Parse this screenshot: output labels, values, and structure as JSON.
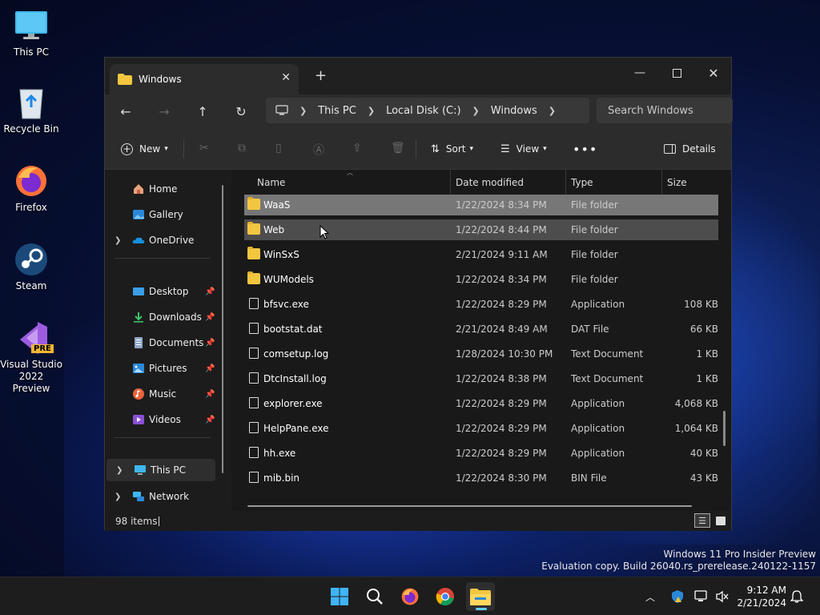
{
  "desktop": {
    "icons": [
      {
        "label": "This PC",
        "icon": "monitor-icon"
      },
      {
        "label": "Recycle Bin",
        "icon": "recycle-bin-icon"
      },
      {
        "label": "Firefox",
        "icon": "firefox-icon"
      },
      {
        "label": "Steam",
        "icon": "steam-icon"
      },
      {
        "label": "Visual Studio 2022 Preview",
        "line1": "Visual Studio",
        "line2": "2022 Preview",
        "badge": "PRE",
        "icon": "visual-studio-icon"
      }
    ]
  },
  "window": {
    "tab_title": "Windows",
    "address": {
      "crumbs": [
        "This PC",
        "Local Disk (C:)",
        "Windows"
      ]
    },
    "search_placeholder": "Search Windows",
    "toolbar": {
      "new_label": "New",
      "sort_label": "Sort",
      "view_label": "View",
      "details_label": "Details"
    },
    "navpane": {
      "home": "Home",
      "gallery": "Gallery",
      "onedrive": "OneDrive",
      "desktop": "Desktop",
      "downloads": "Downloads",
      "documents": "Documents",
      "pictures": "Pictures",
      "music": "Music",
      "videos": "Videos",
      "thispc": "This PC",
      "network": "Network"
    },
    "columns": {
      "name": "Name",
      "date": "Date modified",
      "type": "Type",
      "size": "Size"
    },
    "files": [
      {
        "name": "WaaS",
        "date": "1/22/2024 8:34 PM",
        "type": "File folder",
        "size": "",
        "kind": "folder"
      },
      {
        "name": "Web",
        "date": "1/22/2024 8:44 PM",
        "type": "File folder",
        "size": "",
        "kind": "folder"
      },
      {
        "name": "WinSxS",
        "date": "2/21/2024 9:11 AM",
        "type": "File folder",
        "size": "",
        "kind": "folder"
      },
      {
        "name": "WUModels",
        "date": "1/22/2024 8:34 PM",
        "type": "File folder",
        "size": "",
        "kind": "folder"
      },
      {
        "name": "bfsvc.exe",
        "date": "1/22/2024 8:29 PM",
        "type": "Application",
        "size": "108 KB",
        "kind": "file"
      },
      {
        "name": "bootstat.dat",
        "date": "2/21/2024 8:49 AM",
        "type": "DAT File",
        "size": "66 KB",
        "kind": "file"
      },
      {
        "name": "comsetup.log",
        "date": "1/28/2024 10:30 PM",
        "type": "Text Document",
        "size": "1 KB",
        "kind": "file"
      },
      {
        "name": "DtcInstall.log",
        "date": "1/22/2024 8:38 PM",
        "type": "Text Document",
        "size": "1 KB",
        "kind": "file"
      },
      {
        "name": "explorer.exe",
        "date": "1/22/2024 8:29 PM",
        "type": "Application",
        "size": "4,068 KB",
        "kind": "file"
      },
      {
        "name": "HelpPane.exe",
        "date": "1/22/2024 8:29 PM",
        "type": "Application",
        "size": "1,064 KB",
        "kind": "file"
      },
      {
        "name": "hh.exe",
        "date": "1/22/2024 8:29 PM",
        "type": "Application",
        "size": "40 KB",
        "kind": "file"
      },
      {
        "name": "mib.bin",
        "date": "1/22/2024 8:30 PM",
        "type": "BIN File",
        "size": "43 KB",
        "kind": "file"
      }
    ],
    "status_count": "98 items"
  },
  "watermark": {
    "line1": "Windows 11 Pro Insider Preview",
    "line2": "Evaluation copy. Build 26040.rs_prerelease.240122-1157"
  },
  "taskbar": {
    "time": "9:12 AM",
    "date": "2/21/2024"
  },
  "colors": {
    "selection": "#777777",
    "hover": "#4d4d4d",
    "accent": "#60cdff",
    "folder": "#f3c640"
  }
}
